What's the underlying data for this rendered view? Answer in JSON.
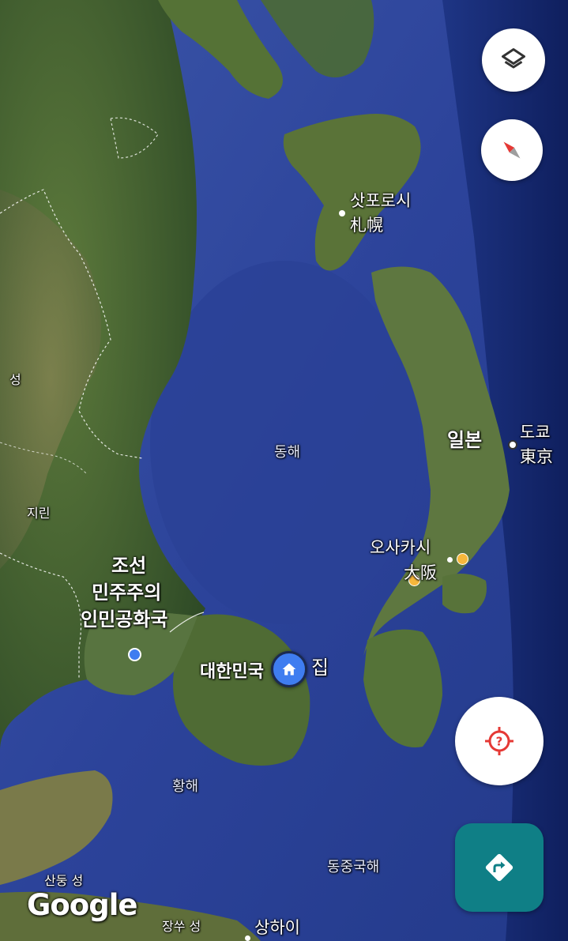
{
  "map": {
    "labels": {
      "sapporo_ko": "삿포로시",
      "sapporo_ja": "札幌",
      "east_sea": "동해",
      "japan": "일본",
      "tokyo_ko": "도쿄",
      "tokyo_ja": "東京",
      "osaka_ko": "오사카시",
      "osaka_ja": "大阪",
      "dprk_line1": "조선",
      "dprk_line2": "민주주의",
      "dprk_line3": "인민공화국",
      "korea": "대한민국",
      "home": "집",
      "jilin": "지린",
      "province_edge": "성",
      "yellow_sea": "황해",
      "east_china_sea": "동중국해",
      "shandong": "산둥 성",
      "jiangsu": "장쑤 성",
      "shanghai": "상하이"
    },
    "logo": "Google"
  },
  "controls": {
    "layers_icon": "layers-icon",
    "compass_icon": "compass-icon",
    "locate_icon": "my-location-icon",
    "directions_icon": "directions-icon"
  },
  "colors": {
    "home_pin": "#3f7df0",
    "osaka_dot": "#f6b73c",
    "directions_button": "#0f7f86",
    "locate_icon": "#e53935"
  }
}
